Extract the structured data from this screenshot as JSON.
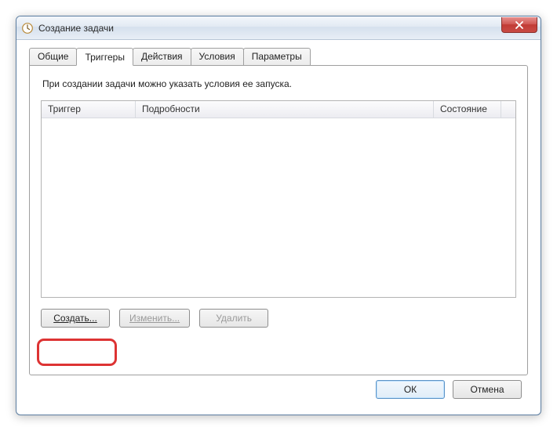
{
  "window": {
    "title": "Создание задачи"
  },
  "tabs": {
    "items": [
      {
        "label": "Общие"
      },
      {
        "label": "Триггеры"
      },
      {
        "label": "Действия"
      },
      {
        "label": "Условия"
      },
      {
        "label": "Параметры"
      }
    ],
    "activeIndex": 1
  },
  "triggers_panel": {
    "description": "При создании задачи можно указать условия ее запуска.",
    "columns": {
      "trigger": "Триггер",
      "details": "Подробности",
      "state": "Состояние"
    },
    "rows": [],
    "buttons": {
      "create": "Создать...",
      "edit": "Изменить...",
      "delete": "Удалить"
    }
  },
  "footer": {
    "ok": "ОК",
    "cancel": "Отмена"
  }
}
